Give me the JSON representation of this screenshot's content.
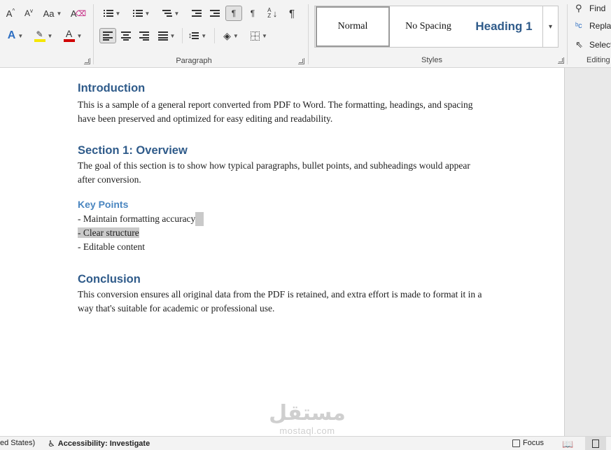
{
  "ribbon": {
    "font_tools": {
      "grow_font_label": "A",
      "shrink_font_label": "A",
      "change_case_label": "Aa",
      "clear_format_label": "A",
      "text_effects_label": "A",
      "highlight_label": "ab",
      "font_color_label": "A",
      "highlight_color": "#f5e600",
      "font_color": "#d00000"
    },
    "paragraph": {
      "label": "Paragraph",
      "show_marks_label": "¶",
      "ltr_label": "¶",
      "rtl_label": "¶",
      "sort_label": "A Z"
    },
    "styles": {
      "label": "Styles",
      "items": [
        "Normal",
        "No Spacing",
        "Heading 1"
      ],
      "more_label": "▾"
    },
    "editing": {
      "label": "Editing",
      "find_label": "Find",
      "replace_label": "Replace",
      "select_label": "Select"
    }
  },
  "document": {
    "sections": [
      {
        "heading": "Introduction",
        "body": "This is a sample of a general report converted from PDF to Word. The formatting, headings, and spacing have been preserved and optimized for easy editing and readability."
      },
      {
        "heading": "Section 1: Overview",
        "body": "The goal of this section is to show how typical paragraphs, bullet points, and subheadings would appear after conversion."
      }
    ],
    "key_points": {
      "heading": "Key Points",
      "items": [
        "- Maintain formatting accuracy",
        "- Clear structure",
        "- Editable content"
      ]
    },
    "conclusion": {
      "heading": "Conclusion",
      "body": "This conversion ensures all original data from the PDF is retained, and extra effort is made to format it in a way that's suitable for academic or professional use."
    }
  },
  "watermark": {
    "arabic": "مستقل",
    "latin": "mostaql.com"
  },
  "statusbar": {
    "language": "ed States)",
    "accessibility": "Accessibility: Investigate",
    "focus": "Focus"
  }
}
